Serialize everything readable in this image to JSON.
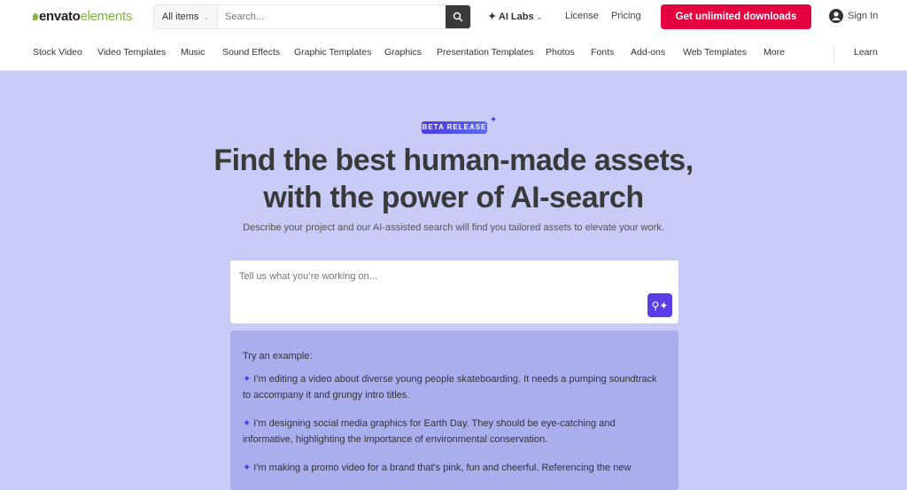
{
  "header": {
    "logo": "envatoelements",
    "logo_bold": "envato",
    "logo_light": "elements",
    "category": "All items",
    "search_placeholder": "Search...",
    "ai_labs": "AI Labs",
    "license": "License",
    "pricing": "Pricing",
    "cta": "Get unlimited downloads",
    "sign_in": "Sign In"
  },
  "nav": {
    "items": [
      "Stock Video",
      "Video Templates",
      "Music",
      "Sound Effects",
      "Graphic Templates",
      "Graphics",
      "Presentation Templates",
      "Photos",
      "Fonts",
      "Add-ons",
      "Web Templates",
      "More"
    ],
    "learn": "Learn"
  },
  "hero": {
    "badge": "BETA RELEASE",
    "title_line1": "Find the best human-made assets,",
    "title_line2": "with the power of AI-search",
    "subtitle": "Describe your project and our AI-assisted search will find you tailored assets to elevate your work.",
    "input_placeholder": "Tell us what you’re working on..."
  },
  "examples": {
    "heading": "Try an example:",
    "items": [
      "I'm editing a video about diverse young people skateboarding. It needs a pumping soundtrack to accompany it and grungy intro titles.",
      "I'm designing social media graphics for Earth Day. They should be eye-catching and informative, highlighting the importance of environmental conservation.",
      "I'm making a promo video for a brand that's pink, fun and cheerful. Referencing the new"
    ]
  },
  "colors": {
    "accent": "#5a3de6",
    "cta": "#e4013f",
    "background": "#c8cbf6",
    "brand_green": "#82b541"
  }
}
